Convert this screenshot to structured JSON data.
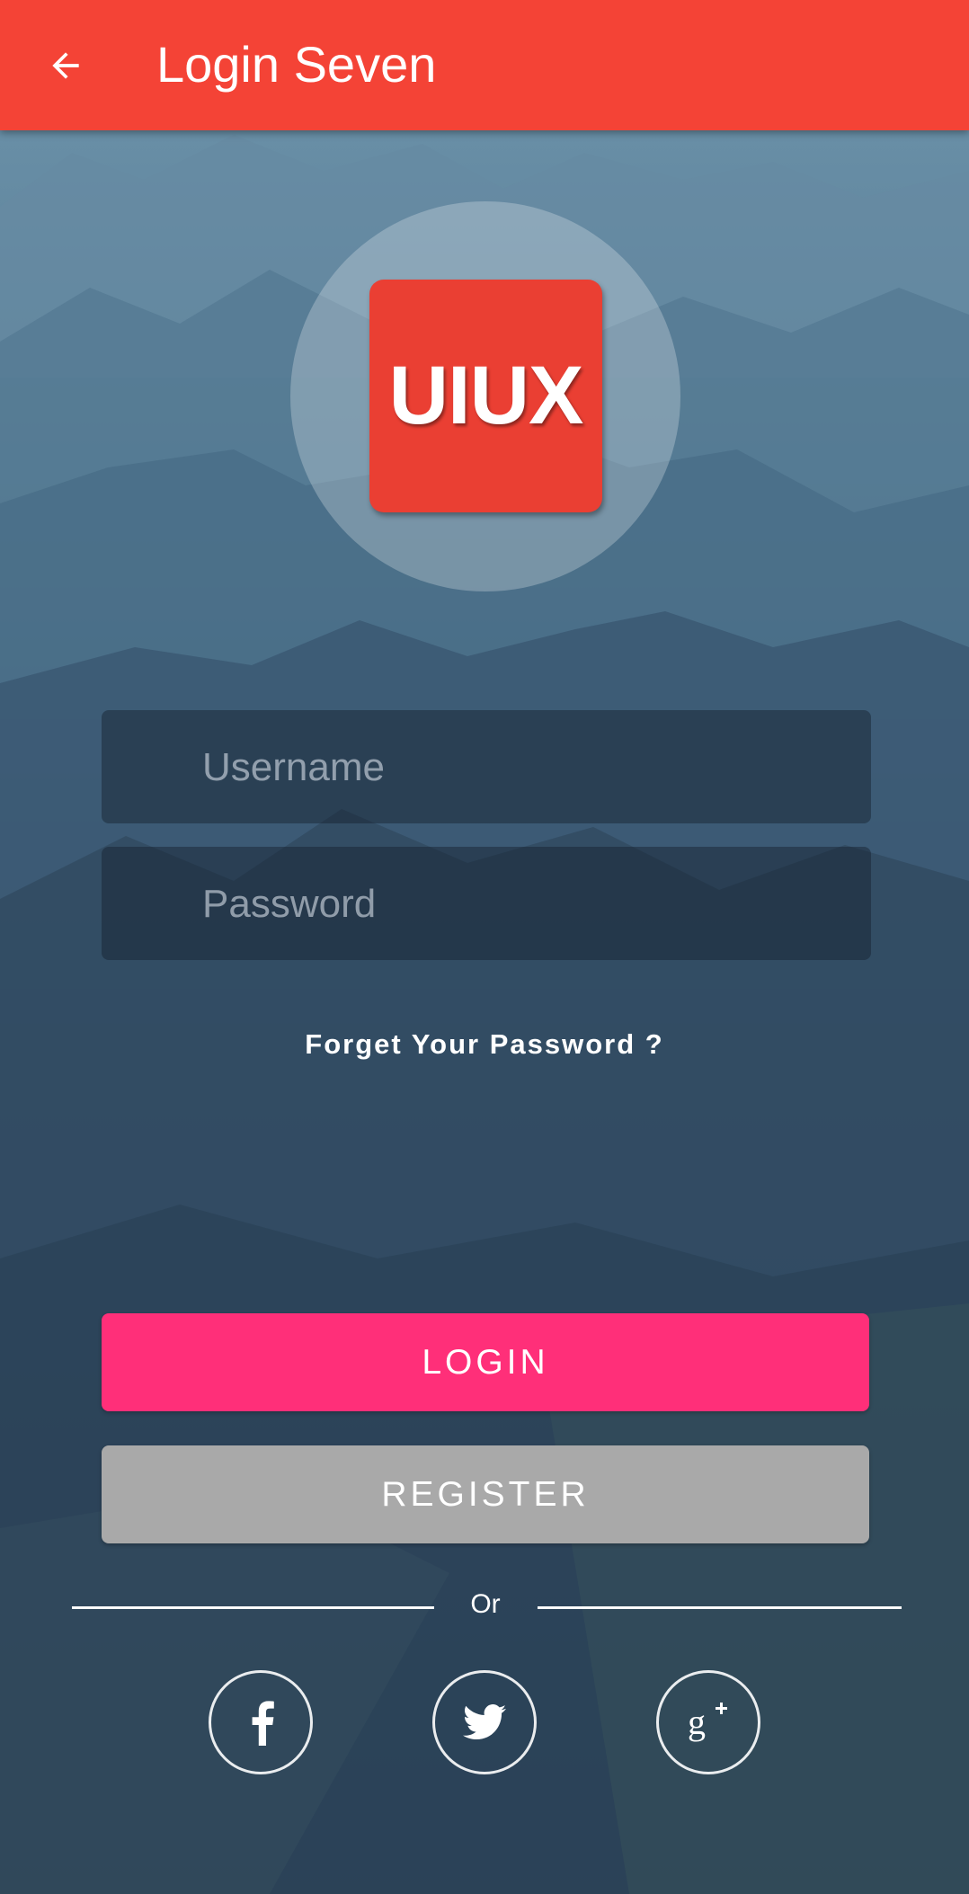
{
  "app_bar": {
    "title": "Login Seven",
    "back_icon": "arrow-back-icon",
    "color": "#f44336"
  },
  "logo": {
    "text": "UIUX",
    "color": "#ea3f33"
  },
  "form": {
    "username_placeholder": "Username",
    "password_placeholder": "Password",
    "forgot_label": "Forget Your Password ?"
  },
  "buttons": {
    "login_label": "LOGIN",
    "login_color": "#ff2f79",
    "register_label": "REGISTER",
    "register_color": "#a9a9a9"
  },
  "divider": {
    "or_label": "Or"
  },
  "social": [
    {
      "name": "facebook",
      "icon": "facebook-icon"
    },
    {
      "name": "twitter",
      "icon": "twitter-icon"
    },
    {
      "name": "google-plus",
      "icon": "google-plus-icon"
    }
  ]
}
